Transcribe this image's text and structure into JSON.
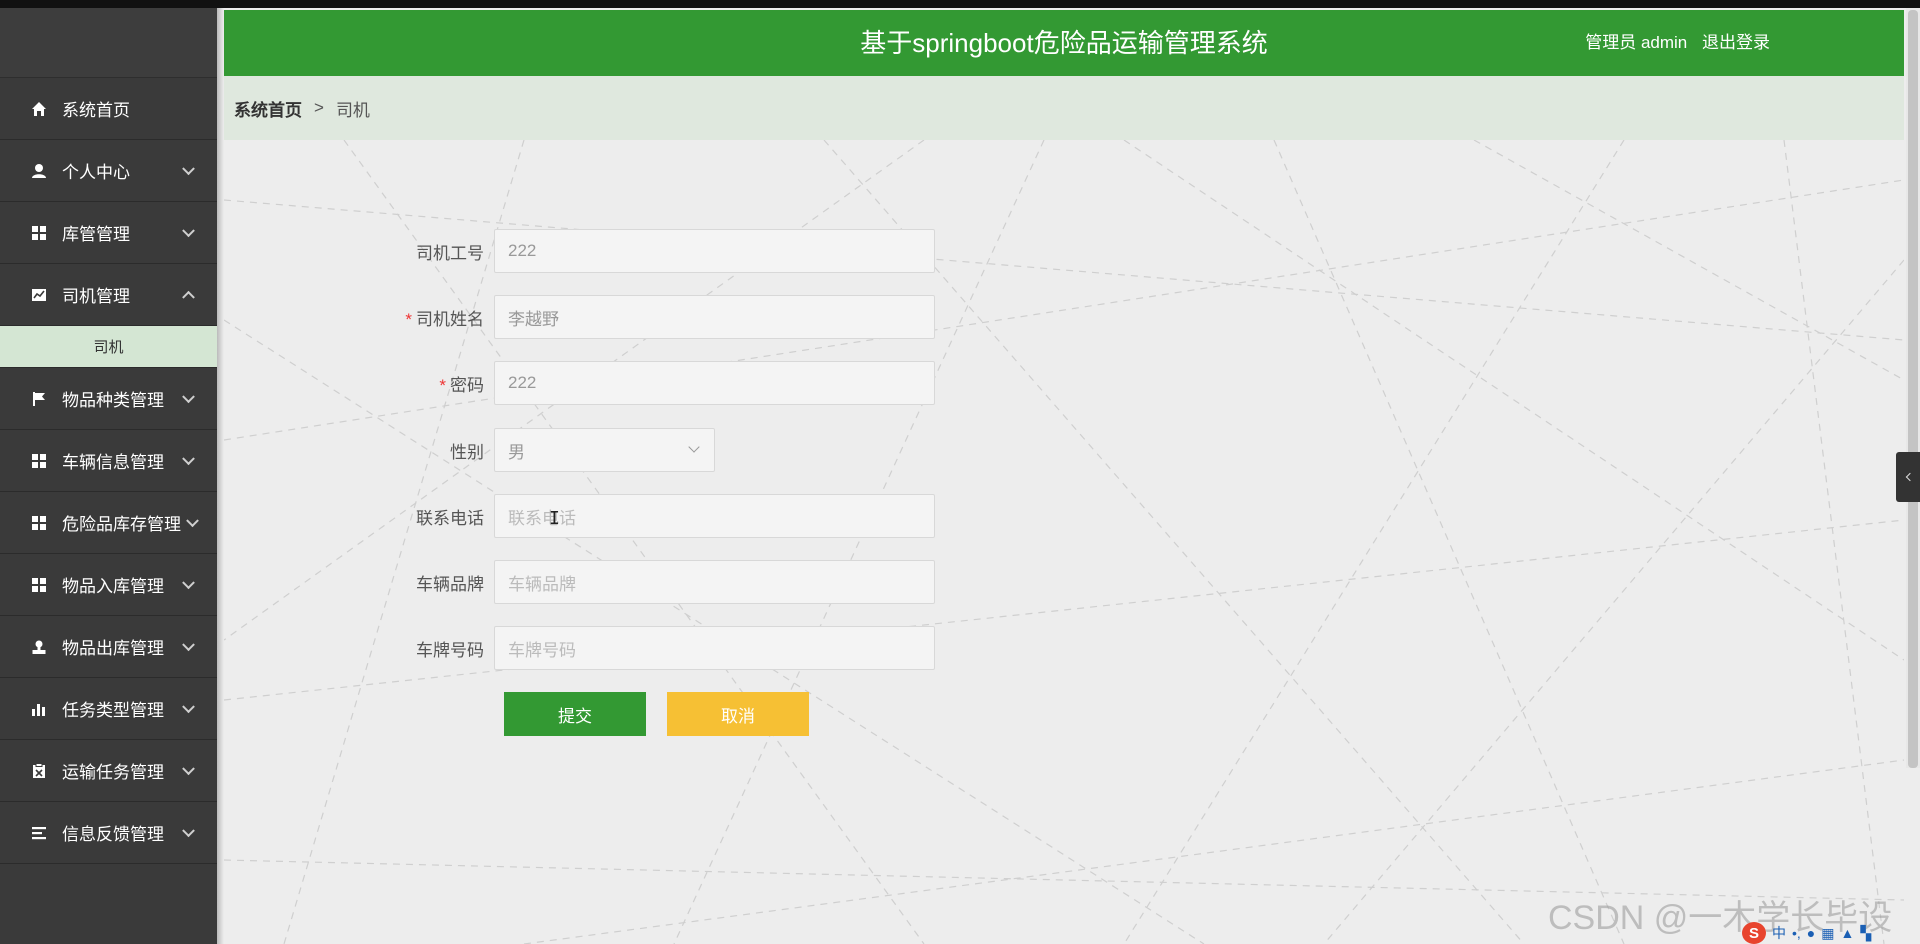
{
  "header": {
    "title": "基于springboot危险品运输管理系统",
    "role": "管理员 admin",
    "logout": "退出登录"
  },
  "breadcrumb": {
    "home": "系统首页",
    "separator": ">",
    "current": "司机"
  },
  "sidebar": {
    "items": [
      {
        "label": "系统首页",
        "icon": "home-icon"
      },
      {
        "label": "个人中心",
        "icon": "user-icon"
      },
      {
        "label": "库管管理",
        "icon": "grid-icon"
      },
      {
        "label": "司机管理",
        "icon": "chart-icon",
        "expanded": true
      },
      {
        "label": "物品种类管理",
        "icon": "flag-icon"
      },
      {
        "label": "车辆信息管理",
        "icon": "grid-icon"
      },
      {
        "label": "危险品库存管理",
        "icon": "grid-icon"
      },
      {
        "label": "物品入库管理",
        "icon": "grid-icon"
      },
      {
        "label": "物品出库管理",
        "icon": "stamp-icon"
      },
      {
        "label": "任务类型管理",
        "icon": "bar-chart-icon"
      },
      {
        "label": "运输任务管理",
        "icon": "clipboard-icon"
      },
      {
        "label": "信息反馈管理",
        "icon": "list-icon"
      }
    ],
    "submenu": {
      "label": "司机"
    }
  },
  "form": {
    "fields": [
      {
        "label": "司机工号",
        "required": false,
        "value": "222",
        "placeholder": ""
      },
      {
        "label": "司机姓名",
        "required": true,
        "value": "李越野",
        "placeholder": ""
      },
      {
        "label": "密码",
        "required": true,
        "value": "222",
        "placeholder": ""
      },
      {
        "label": "性别",
        "required": false,
        "value": "男",
        "placeholder": ""
      },
      {
        "label": "联系电话",
        "required": false,
        "value": "",
        "placeholder": "联系电话"
      },
      {
        "label": "车辆品牌",
        "required": false,
        "value": "",
        "placeholder": "车辆品牌"
      },
      {
        "label": "车牌号码",
        "required": false,
        "value": "",
        "placeholder": "车牌号码"
      }
    ],
    "submit_label": "提交",
    "cancel_label": "取消"
  },
  "watermark": "CSDN @一木学长毕设",
  "ime": {
    "logo": "S",
    "lang": "中"
  },
  "colors": {
    "primary": "#339933",
    "cancel": "#f6c034",
    "sidebar": "#3a3a3a"
  }
}
